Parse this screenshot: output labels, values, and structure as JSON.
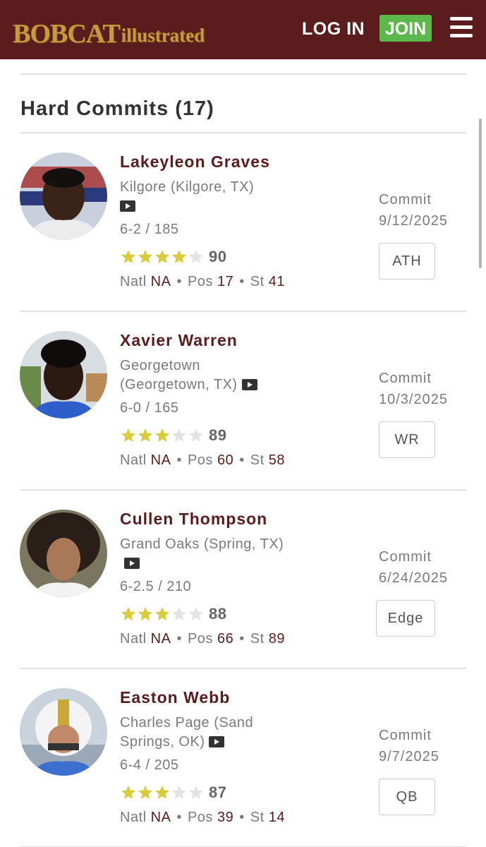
{
  "header": {
    "logo_main": "BOBCAT",
    "logo_sub": "illustrated",
    "login_label": "LOG IN",
    "join_label": "JOIN",
    "brand_color": "#5a1c1c",
    "join_color": "#5cb84a"
  },
  "section": {
    "title": "Hard Commits (17)"
  },
  "recruits": [
    {
      "name": "Lakeyleon Graves",
      "school": "Kilgore (Kilgore, TX)",
      "height_weight": "6-2 / 185",
      "stars": 4,
      "rating": "90",
      "natl_label": "Natl",
      "natl": "NA",
      "pos_label": "Pos",
      "pos": "17",
      "st_label": "St",
      "st": "41",
      "commit_label": "Commit",
      "commit_date": "9/12/2025",
      "position": "ATH",
      "video_icon": "video-play-icon"
    },
    {
      "name": "Xavier Warren",
      "school": "Georgetown (Georgetown, TX)",
      "height_weight": "6-0 / 165",
      "stars": 3,
      "rating": "89",
      "natl_label": "Natl",
      "natl": "NA",
      "pos_label": "Pos",
      "pos": "60",
      "st_label": "St",
      "st": "58",
      "commit_label": "Commit",
      "commit_date": "10/3/2025",
      "position": "WR",
      "video_icon": "video-play-icon"
    },
    {
      "name": "Cullen Thompson",
      "school": "Grand Oaks (Spring, TX)",
      "height_weight": "6-2.5 / 210",
      "stars": 3,
      "rating": "88",
      "natl_label": "Natl",
      "natl": "NA",
      "pos_label": "Pos",
      "pos": "66",
      "st_label": "St",
      "st": "89",
      "commit_label": "Commit",
      "commit_date": "6/24/2025",
      "position": "Edge",
      "video_icon": "video-play-icon"
    },
    {
      "name": "Easton Webb",
      "school": "Charles Page (Sand Springs, OK)",
      "height_weight": "6-4 / 205",
      "stars": 3,
      "rating": "87",
      "natl_label": "Natl",
      "natl": "NA",
      "pos_label": "Pos",
      "pos": "39",
      "st_label": "St",
      "st": "14",
      "commit_label": "Commit",
      "commit_date": "9/7/2025",
      "position": "QB",
      "video_icon": "video-play-icon"
    }
  ],
  "star_colors": {
    "filled": "#d9cc3c",
    "empty": "#e3e3e3"
  }
}
